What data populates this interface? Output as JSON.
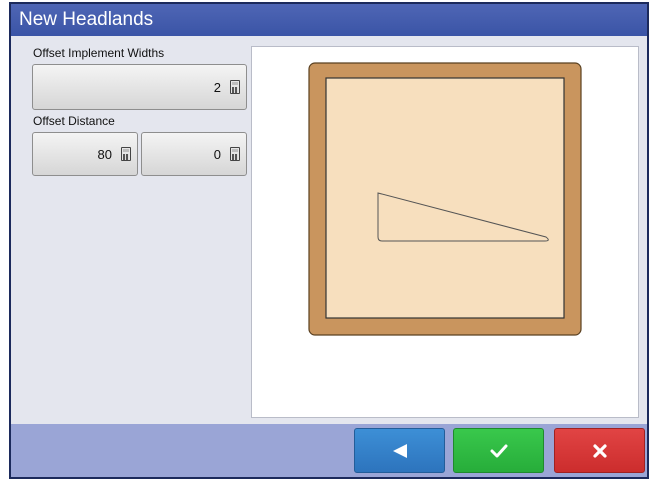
{
  "window": {
    "title": "New Headlands"
  },
  "fields": {
    "offset_implement_widths": {
      "label": "Offset Implement Widths",
      "value": "2"
    },
    "offset_distance": {
      "label": "Offset Distance",
      "value_primary": "80",
      "value_secondary": "0"
    }
  },
  "icons": {
    "calculator": "calculator-icon",
    "back": "left-arrow-icon",
    "accept": "checkmark-icon",
    "cancel": "x-icon"
  },
  "colors": {
    "title_bar": "#3a54a6",
    "field_border": "#c9955e",
    "field_fill": "#f7dfbe",
    "back_button": "#2d74bd",
    "accept_button": "#27ad3a",
    "cancel_button": "#cc2d2d",
    "footer": "#9aa5d6"
  }
}
